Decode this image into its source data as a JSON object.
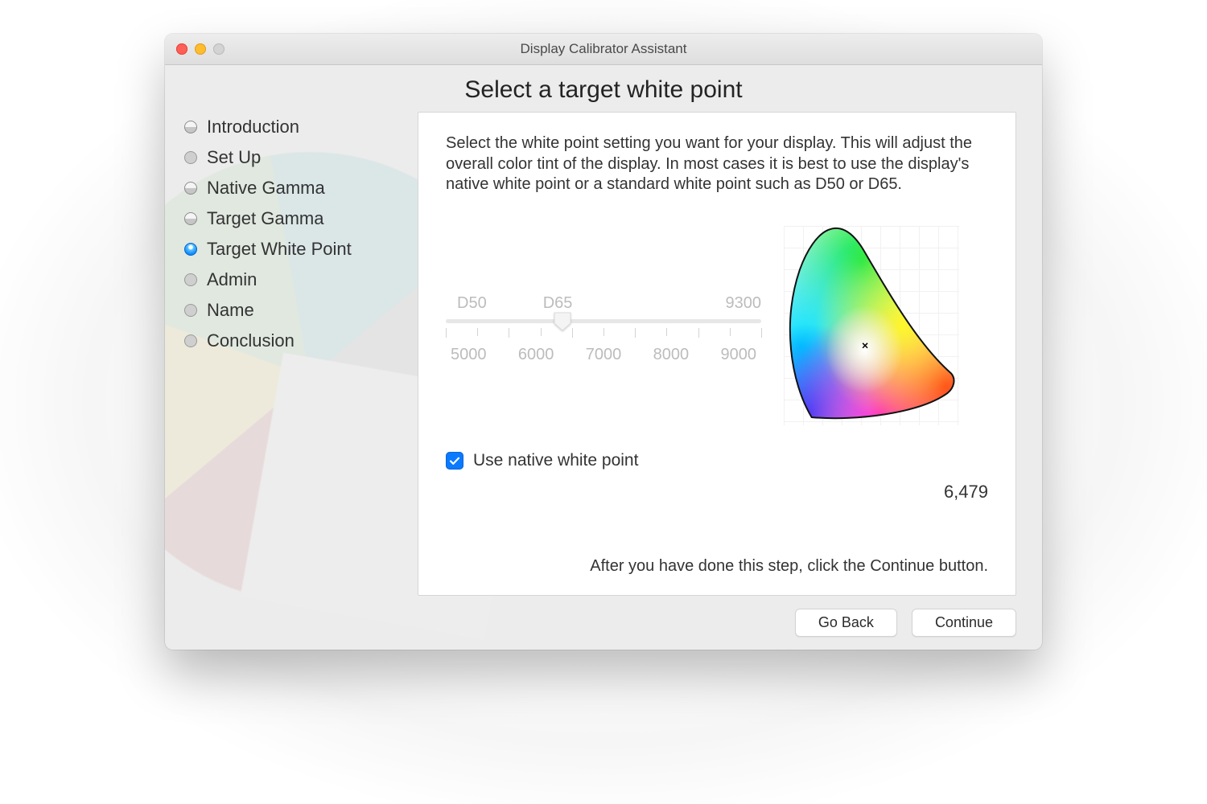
{
  "window": {
    "title": "Display Calibrator Assistant"
  },
  "page_title": "Select a target white point",
  "sidebar": {
    "items": [
      {
        "label": "Introduction",
        "state": "done"
      },
      {
        "label": "Set Up",
        "state": "pending"
      },
      {
        "label": "Native Gamma",
        "state": "done"
      },
      {
        "label": "Target Gamma",
        "state": "done"
      },
      {
        "label": "Target White Point",
        "state": "current"
      },
      {
        "label": "Admin",
        "state": "pending"
      },
      {
        "label": "Name",
        "state": "pending"
      },
      {
        "label": "Conclusion",
        "state": "pending"
      }
    ]
  },
  "content": {
    "description": "Select the white point setting you want for your display.  This will adjust the overall color tint of the display.  In most cases it is best to use the display's native white point or a standard white point such as D50 or D65.",
    "slider": {
      "named_labels": [
        "D50",
        "D65",
        "9300"
      ],
      "tick_values": [
        "5000",
        "6000",
        "7000",
        "8000",
        "9000"
      ],
      "tick_count": 11,
      "thumb_position_pct": 37,
      "enabled": false
    },
    "checkbox": {
      "label": "Use native white point",
      "checked": true
    },
    "value": "6,479",
    "footer": "After you have done this step, click the Continue button."
  },
  "buttons": {
    "back": "Go Back",
    "continue": "Continue"
  }
}
